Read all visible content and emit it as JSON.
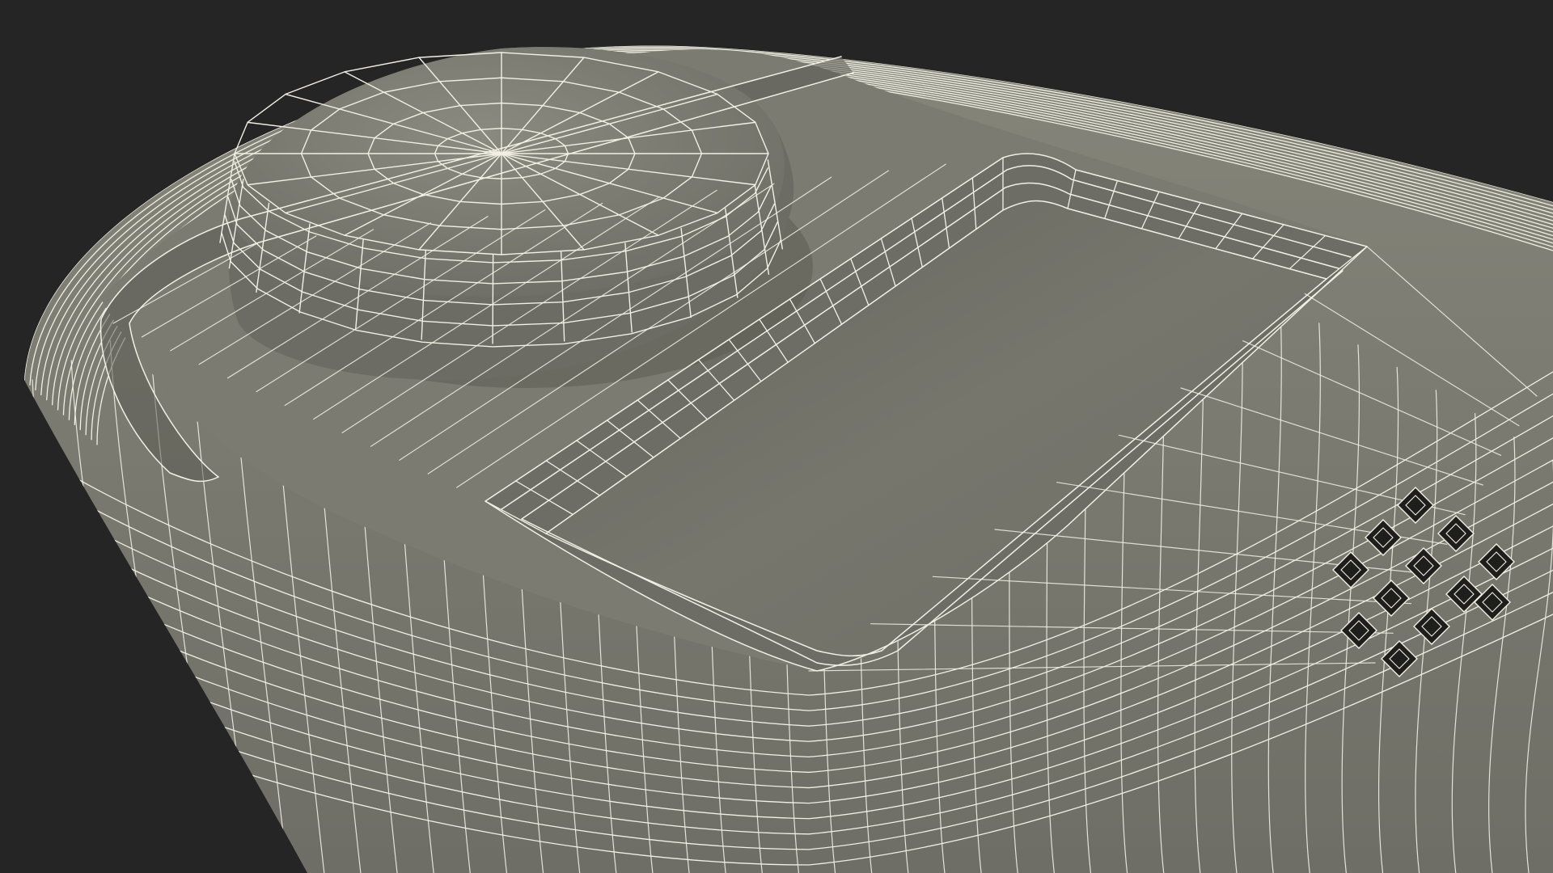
{
  "scene": {
    "subject": "wireframe-3d-device-model",
    "background_color": "#252525",
    "surface_color": "#7a7a70",
    "surface_dark_color": "#6b6b62",
    "shadow_color": "#4a4a44",
    "screen_color": "#72726a",
    "wire_color": "#f2f0e4",
    "vent_hole_color": "#1e1e1c",
    "vent_hole_count": 12,
    "vent_layout": "diamond-grid"
  }
}
